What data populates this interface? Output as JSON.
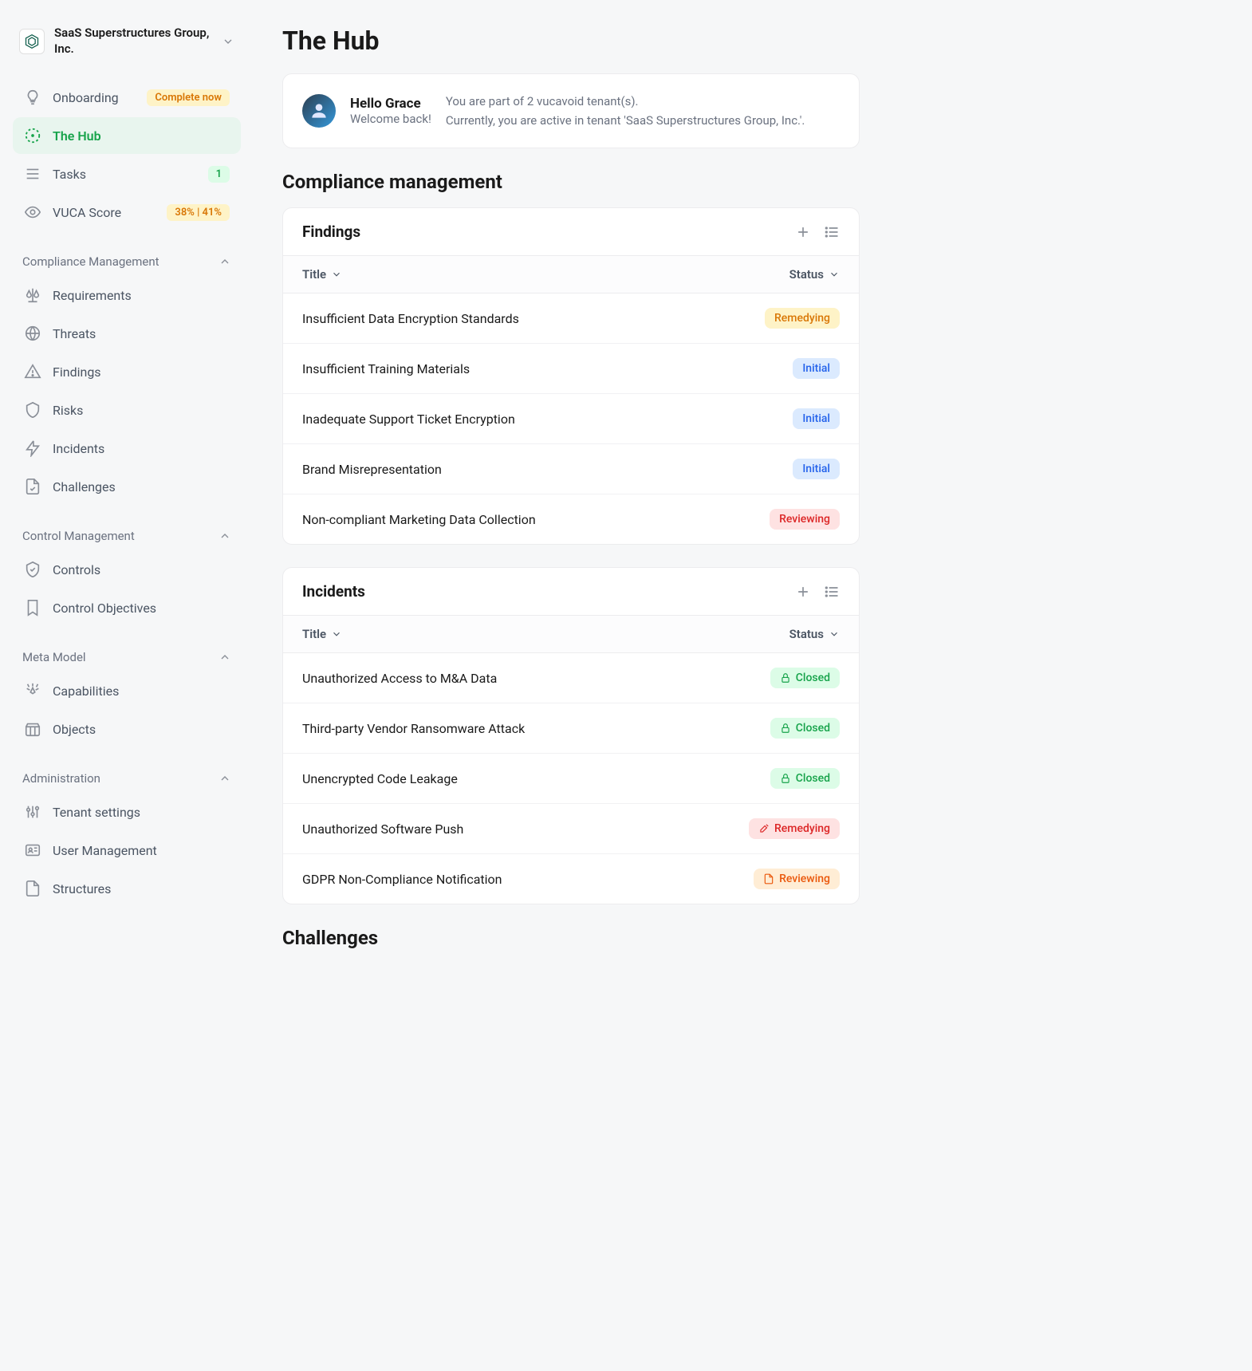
{
  "tenant": {
    "name": "SaaS Superstructures Group, Inc."
  },
  "nav": {
    "top": [
      {
        "key": "onboarding",
        "label": "Onboarding",
        "badge": "Complete now",
        "badge_class": "badge-amber"
      },
      {
        "key": "the-hub",
        "label": "The Hub",
        "active": true
      },
      {
        "key": "tasks",
        "label": "Tasks",
        "badge": "1",
        "badge_class": "badge-green-light"
      },
      {
        "key": "vuca-score",
        "label": "VUCA Score",
        "badge": "38% | 41%",
        "badge_class": "badge-amber"
      }
    ],
    "groups": [
      {
        "title": "Compliance Management",
        "items": [
          {
            "key": "requirements",
            "label": "Requirements"
          },
          {
            "key": "threats",
            "label": "Threats"
          },
          {
            "key": "findings",
            "label": "Findings"
          },
          {
            "key": "risks",
            "label": "Risks"
          },
          {
            "key": "incidents",
            "label": "Incidents"
          },
          {
            "key": "challenges",
            "label": "Challenges"
          }
        ]
      },
      {
        "title": "Control Management",
        "items": [
          {
            "key": "controls",
            "label": "Controls"
          },
          {
            "key": "control-objectives",
            "label": "Control Objectives"
          }
        ]
      },
      {
        "title": "Meta Model",
        "items": [
          {
            "key": "capabilities",
            "label": "Capabilities"
          },
          {
            "key": "objects",
            "label": "Objects"
          }
        ]
      },
      {
        "title": "Administration",
        "items": [
          {
            "key": "tenant-settings",
            "label": "Tenant settings"
          },
          {
            "key": "user-management",
            "label": "User Management"
          },
          {
            "key": "structures",
            "label": "Structures"
          }
        ]
      }
    ]
  },
  "page": {
    "title": "The Hub"
  },
  "welcome": {
    "hello": "Hello Grace",
    "sub": "Welcome back!",
    "line1": "You are part of 2 vucavoid tenant(s).",
    "line2": "Currently, you are active in tenant 'SaaS Superstructures Group, Inc.'."
  },
  "sections": {
    "compliance": {
      "title": "Compliance management",
      "findings": {
        "title": "Findings",
        "columns": {
          "title": "Title",
          "status": "Status"
        },
        "rows": [
          {
            "title": "Insufficient Data Encryption Standards",
            "status": "Remedying",
            "class": "st-remedying"
          },
          {
            "title": "Insufficient Training Materials",
            "status": "Initial",
            "class": "st-initial"
          },
          {
            "title": "Inadequate Support Ticket Encryption",
            "status": "Initial",
            "class": "st-initial"
          },
          {
            "title": "Brand Misrepresentation",
            "status": "Initial",
            "class": "st-initial"
          },
          {
            "title": "Non-compliant Marketing Data Collection",
            "status": "Reviewing",
            "class": "st-reviewing"
          }
        ]
      },
      "incidents": {
        "title": "Incidents",
        "columns": {
          "title": "Title",
          "status": "Status"
        },
        "rows": [
          {
            "title": "Unauthorized Access to M&A Data",
            "status": "Closed",
            "class": "st-closed",
            "icon": "lock"
          },
          {
            "title": "Third-party Vendor Ransomware Attack",
            "status": "Closed",
            "class": "st-closed",
            "icon": "lock"
          },
          {
            "title": "Unencrypted Code Leakage",
            "status": "Closed",
            "class": "st-closed",
            "icon": "lock"
          },
          {
            "title": "Unauthorized Software Push",
            "status": "Remedying",
            "class": "st-remedying-red",
            "icon": "tools"
          },
          {
            "title": "GDPR Non-Compliance Notification",
            "status": "Reviewing",
            "class": "st-reviewing-orange",
            "icon": "doc"
          }
        ]
      },
      "challenges": {
        "title": "Challenges"
      }
    }
  }
}
